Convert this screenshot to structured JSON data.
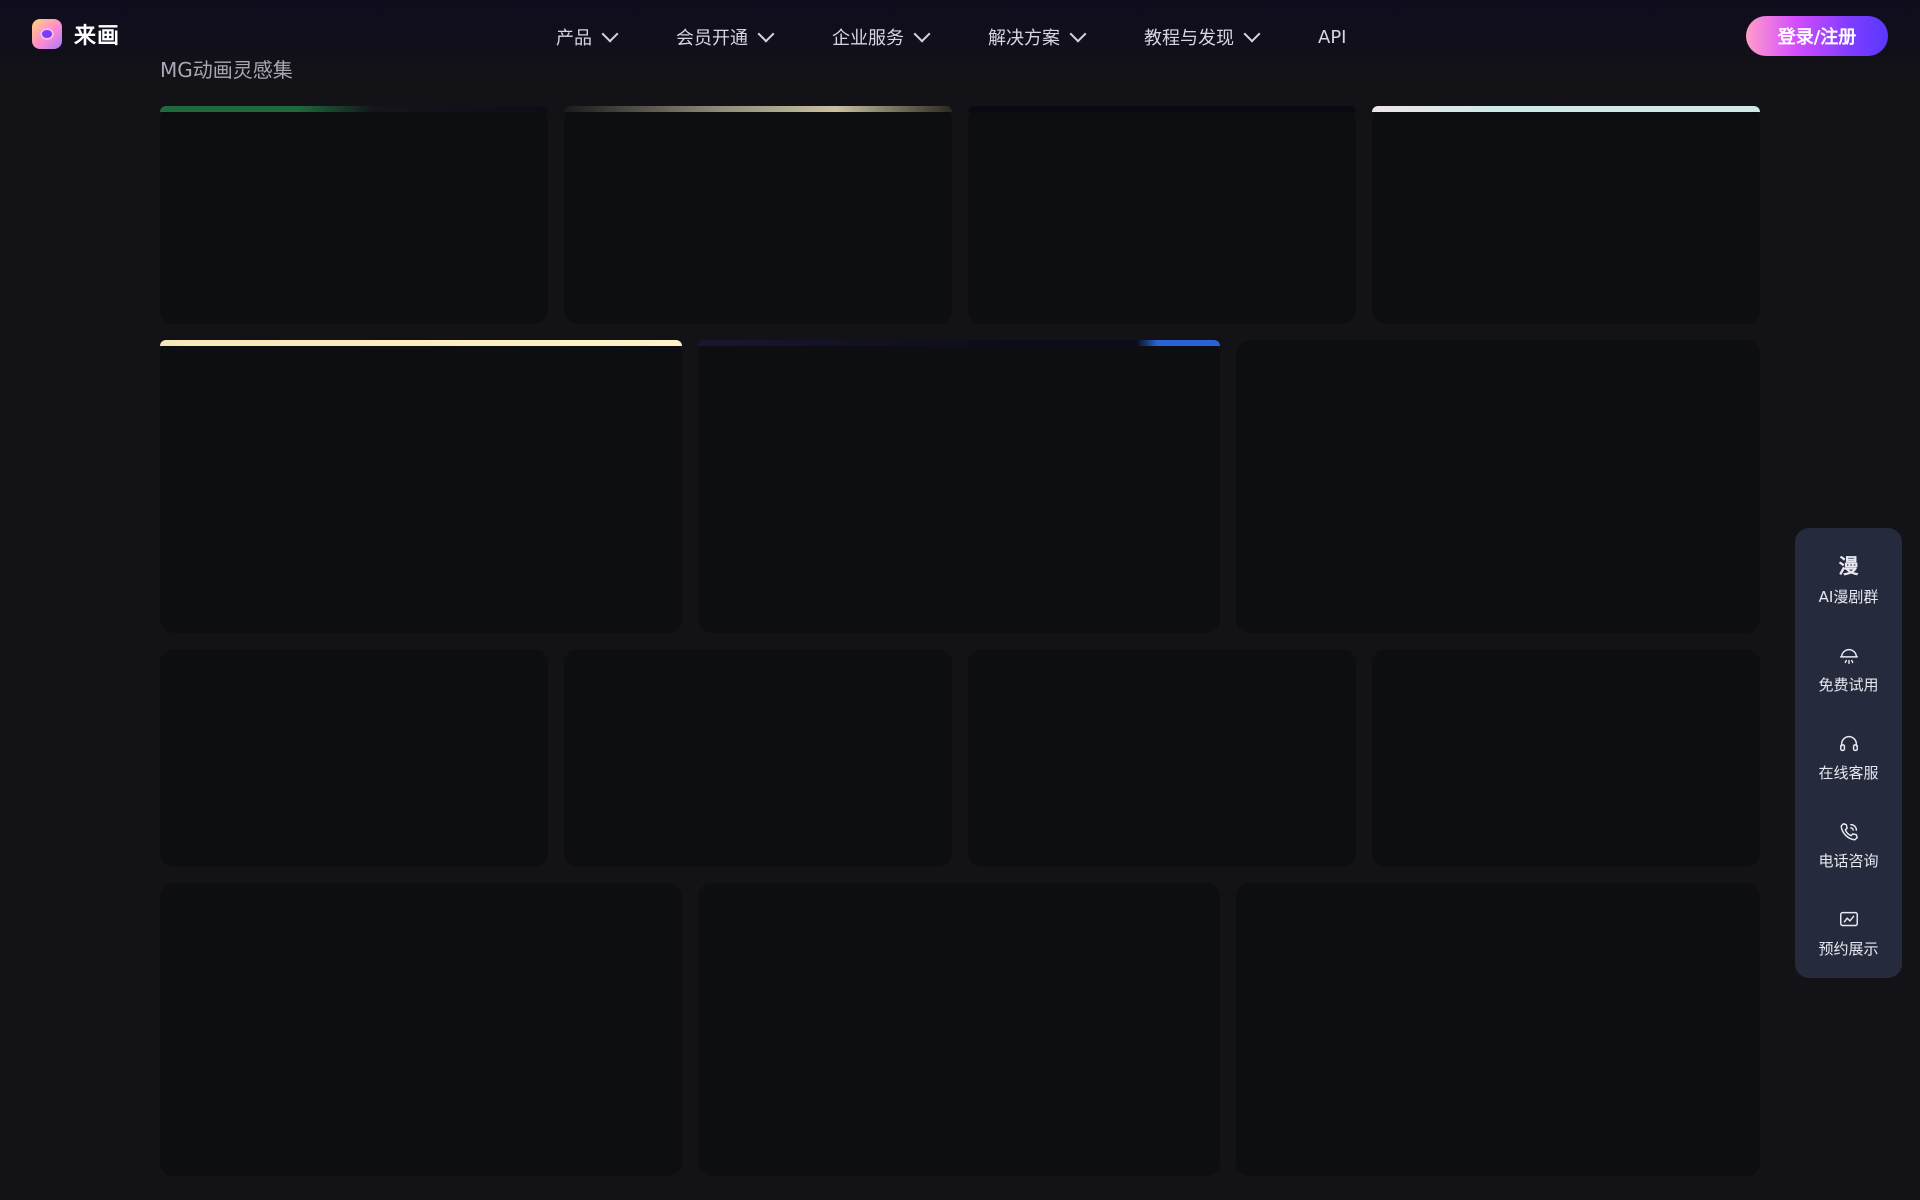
{
  "header": {
    "logo_text": "来画",
    "nav": [
      {
        "label": "产品"
      },
      {
        "label": "会员开通"
      },
      {
        "label": "企业服务"
      },
      {
        "label": "解决方案"
      },
      {
        "label": "教程与发现"
      }
    ],
    "nav_api": "API",
    "login_label": "登录/注册"
  },
  "section": {
    "title": "MG动画灵感集"
  },
  "float_panel": {
    "items": [
      {
        "label": "AI漫剧群",
        "icon": "漫"
      },
      {
        "label": "免费试用"
      },
      {
        "label": "在线客服"
      },
      {
        "label": "电话咨询"
      },
      {
        "label": "预约展示"
      }
    ]
  },
  "colors": {
    "background": "#121217",
    "card": "#0d0e12",
    "accent_gradient_start": "#ff9ec8",
    "accent_gradient_end": "#5a38ff",
    "panel": "#262a3d"
  }
}
